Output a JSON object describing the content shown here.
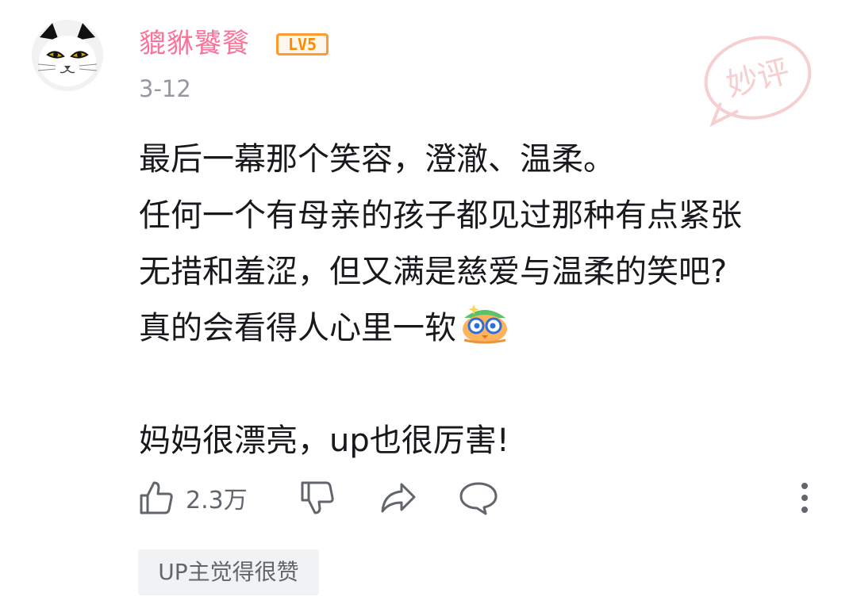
{
  "comment": {
    "username": "貔貅饕餮",
    "level_badge": "LV5",
    "date": "3-12",
    "stamp_text": "妙评",
    "lines": [
      "最后一幕那个笑容，澄澈、温柔。",
      "任何一个有母亲的孩子都见过那种有点紧张",
      "无措和羞涩，但又满是慈爱与温柔的笑吧?",
      "真的会看得人心里一软",
      "",
      "妈妈很漂亮，up也很厉害!"
    ],
    "emoji_icon": "bilibili-sticker-emoji-icon"
  },
  "actions": {
    "like_count": "2.3万",
    "icons": [
      "thumbs-up-icon",
      "thumbs-down-icon",
      "share-icon",
      "reply-icon",
      "more-vertical-icon"
    ]
  },
  "tag": {
    "label": "UP主觉得很赞"
  },
  "colors": {
    "username": "#fb7299",
    "badge": "#ff8a00",
    "secondary_text": "#9499a0",
    "icon": "#61666d",
    "tag_bg": "#f1f2f3"
  }
}
